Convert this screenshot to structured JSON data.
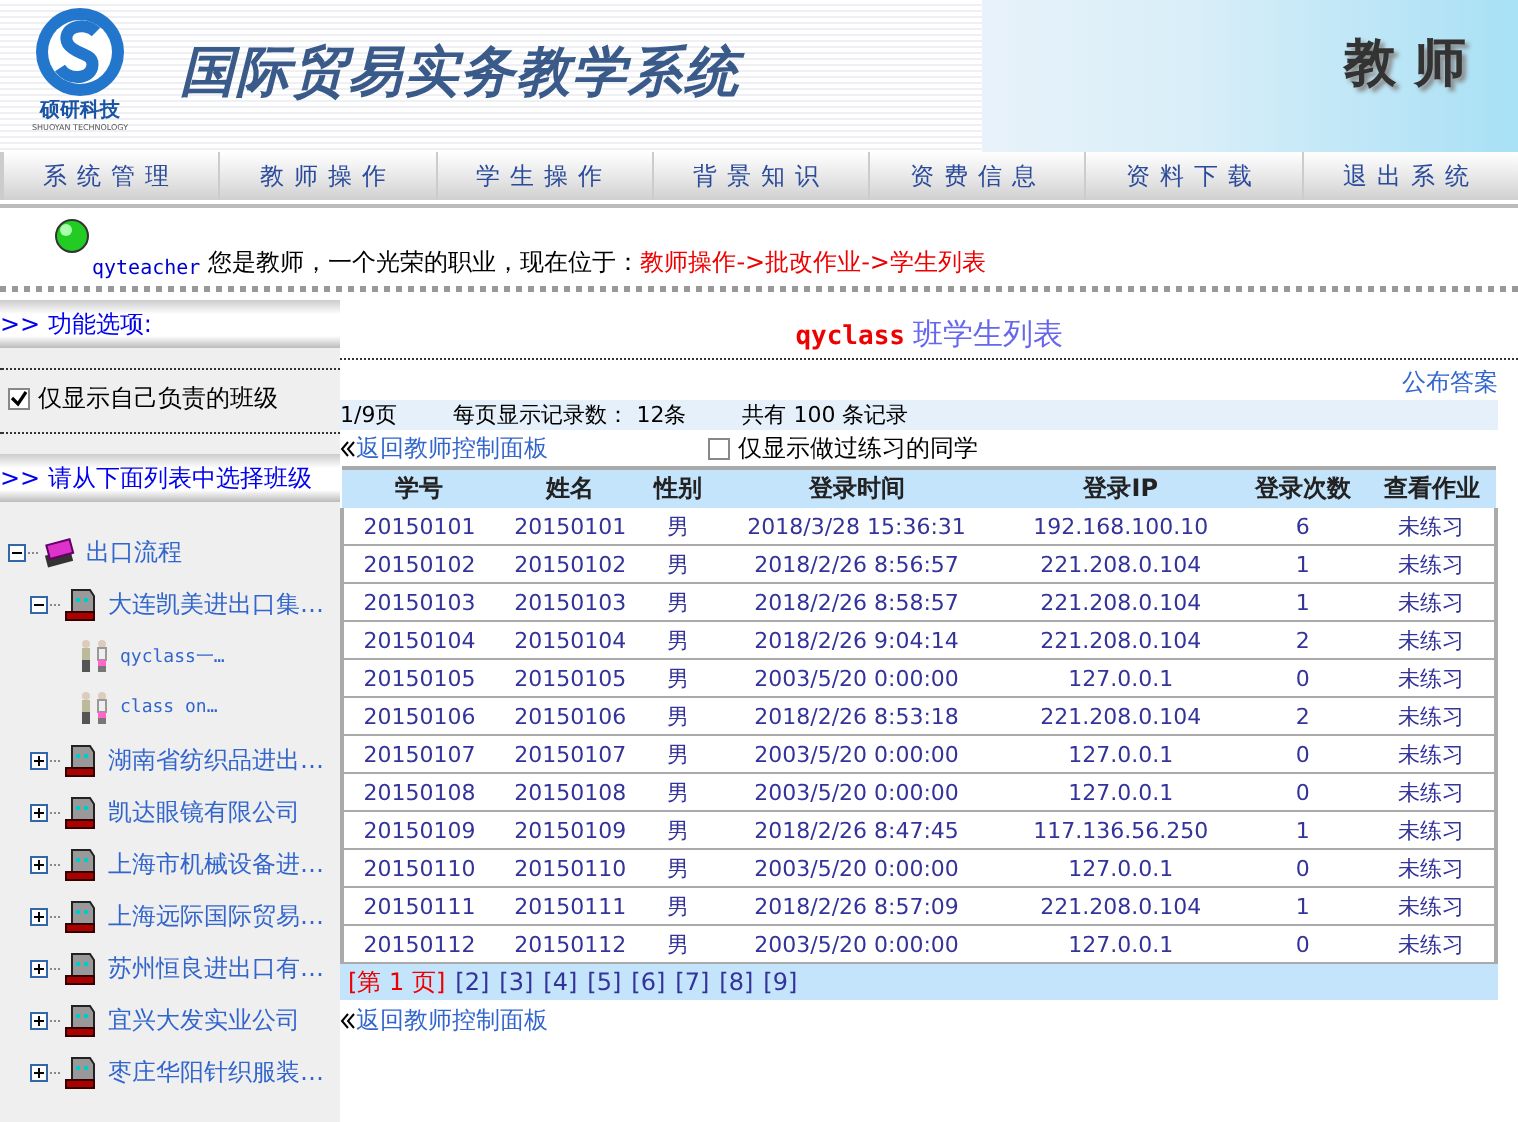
{
  "header": {
    "logo_name": "硕研科技",
    "logo_subtitle": "SHUOYAN TECHNOLOGY",
    "title": "国际贸易实务教学系统",
    "role": "教 师"
  },
  "nav": [
    "系统管理",
    "教师操作",
    "学生操作",
    "背景知识",
    "资费信息",
    "资料下载",
    "退出系统"
  ],
  "info": {
    "user": "qyteacher",
    "message": "您是教师，一个光荣的职业，现在位于：",
    "location": "教师操作->批改作业->学生列表"
  },
  "sidebar": {
    "options_title": ">> 功能选项:",
    "only_mine": {
      "label": "仅显示自己负责的班级",
      "checked": true
    },
    "list_title": ">> 请从下面列表中选择班级",
    "tree": [
      {
        "label": "出口流程",
        "kind": "category",
        "expanded": true,
        "children": [
          {
            "label": "大连凯美进出口集…",
            "kind": "company",
            "expanded": true,
            "children": [
              {
                "label": "qyclass一…",
                "kind": "class"
              },
              {
                "label": "class on…",
                "kind": "class"
              }
            ]
          },
          {
            "label": "湖南省纺织品进出…",
            "kind": "company",
            "expanded": false
          },
          {
            "label": "凯达眼镜有限公司",
            "kind": "company",
            "expanded": false
          },
          {
            "label": "上海市机械设备进…",
            "kind": "company",
            "expanded": false
          },
          {
            "label": "上海远际国际贸易…",
            "kind": "company",
            "expanded": false
          },
          {
            "label": "苏州恒良进出口有…",
            "kind": "company",
            "expanded": false
          },
          {
            "label": "宜兴大发实业公司",
            "kind": "company",
            "expanded": false
          },
          {
            "label": "枣庄华阳针织服装…",
            "kind": "company",
            "expanded": false
          }
        ]
      }
    ]
  },
  "main": {
    "class_name": "qyclass",
    "title": "班学生列表",
    "publish": "公布答案",
    "page_info": "1/9页",
    "per_page": "每页显示记录数： 12条",
    "total": "共有 100 条记录",
    "back": "返回教师控制面板",
    "only_practiced": {
      "label": "仅显示做过练习的同学",
      "checked": false
    },
    "table": {
      "columns": [
        "学号",
        "姓名",
        "性别",
        "登录时间",
        "登录IP",
        "登录次数",
        "查看作业"
      ],
      "rows": [
        [
          "20150101",
          "20150101",
          "男",
          "2018/3/28 15:36:31",
          "192.168.100.10",
          "6",
          "未练习"
        ],
        [
          "20150102",
          "20150102",
          "男",
          "2018/2/26 8:56:57",
          "221.208.0.104",
          "1",
          "未练习"
        ],
        [
          "20150103",
          "20150103",
          "男",
          "2018/2/26 8:58:57",
          "221.208.0.104",
          "1",
          "未练习"
        ],
        [
          "20150104",
          "20150104",
          "男",
          "2018/2/26 9:04:14",
          "221.208.0.104",
          "2",
          "未练习"
        ],
        [
          "20150105",
          "20150105",
          "男",
          "2003/5/20 0:00:00",
          "127.0.0.1",
          "0",
          "未练习"
        ],
        [
          "20150106",
          "20150106",
          "男",
          "2018/2/26 8:53:18",
          "221.208.0.104",
          "2",
          "未练习"
        ],
        [
          "20150107",
          "20150107",
          "男",
          "2003/5/20 0:00:00",
          "127.0.0.1",
          "0",
          "未练习"
        ],
        [
          "20150108",
          "20150108",
          "男",
          "2003/5/20 0:00:00",
          "127.0.0.1",
          "0",
          "未练习"
        ],
        [
          "20150109",
          "20150109",
          "男",
          "2018/2/26 8:47:45",
          "117.136.56.250",
          "1",
          "未练习"
        ],
        [
          "20150110",
          "20150110",
          "男",
          "2003/5/20 0:00:00",
          "127.0.0.1",
          "0",
          "未练习"
        ],
        [
          "20150111",
          "20150111",
          "男",
          "2018/2/26 8:57:09",
          "221.208.0.104",
          "1",
          "未练习"
        ],
        [
          "20150112",
          "20150112",
          "男",
          "2003/5/20 0:00:00",
          "127.0.0.1",
          "0",
          "未练习"
        ]
      ]
    },
    "pages": [
      {
        "label": "[第 1 页]",
        "selected": true
      },
      {
        "label": "[2]",
        "selected": false
      },
      {
        "label": "[3]",
        "selected": false
      },
      {
        "label": "[4]",
        "selected": false
      },
      {
        "label": "[5]",
        "selected": false
      },
      {
        "label": "[6]",
        "selected": false
      },
      {
        "label": "[7]",
        "selected": false
      },
      {
        "label": "[8]",
        "selected": false
      },
      {
        "label": "[9]",
        "selected": false
      }
    ],
    "back_bottom": "返回教师控制面板"
  }
}
